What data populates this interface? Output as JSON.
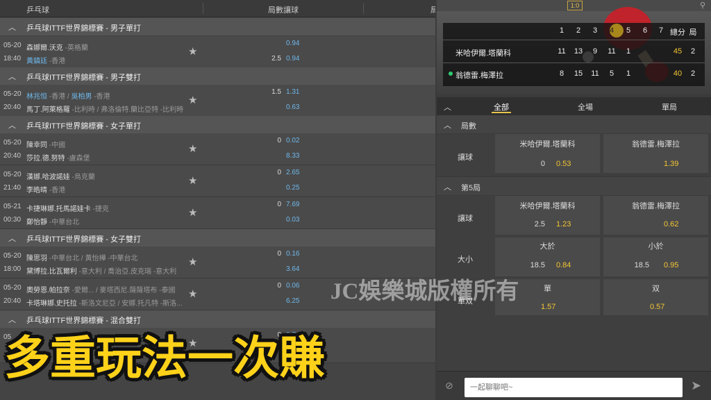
{
  "left_header": {
    "sport": "乒乓球",
    "col_games_handicap": "局數讓球",
    "col_more": "局"
  },
  "sections": [
    {
      "title": "乒乓球ITTF世界錦標賽 - 男子單打"
    },
    {
      "title": "乒乓球ITTF世界錦標賽 - 男子雙打"
    },
    {
      "title": "乒乓球ITTF世界錦標賽 - 女子單打"
    },
    {
      "title": "乒乓球ITTF世界錦標賽 - 女子雙打"
    },
    {
      "title": "乒乓球ITTF世界錦標賽 - 混合雙打"
    }
  ],
  "matches": [
    {
      "date": "05-20",
      "time": "18:40",
      "p1": "森娜爾.沃克",
      "c1": " -英格蘭",
      "p2": "黃鎮廷",
      "c2": " -香港",
      "h1": "",
      "h2": "2.5",
      "o1": "0.94",
      "o2": "0.94"
    },
    {
      "date": "05-20",
      "time": "20:40",
      "p1": "林兆恒",
      "c1": " -香港 / ",
      "p1b": "吳柏男",
      "c1b": " -香港",
      "p2": "馬丁.阿萊格羅",
      "c2": " -比利時 / 弗洛倫特.蘭比亞特 -比利時",
      "h1": "1.5",
      "h2": "",
      "o1": "1.31",
      "o2": "0.63"
    },
    {
      "date": "05-20",
      "time": "20:40",
      "p1": "陳幸同",
      "c1": " -中國",
      "p2": "莎拉.德.努特",
      "c2": " -盧森堡",
      "h1": "0",
      "h2": "",
      "o1": "0.02",
      "o2": "8.33"
    },
    {
      "date": "05-20",
      "time": "21:40",
      "p1": "漢娜.哈波諾娃",
      "c1": " -烏克蘭",
      "p2": "李皓晴",
      "c2": " -香港",
      "h1": "0",
      "h2": "",
      "o1": "2.65",
      "o2": "0.25"
    },
    {
      "date": "05-21",
      "time": "00:30",
      "p1": "卡捷琳娜.托馬諾娃卡",
      "c1": " -捷克",
      "p2": "鄭怡靜",
      "c2": " -中華台北",
      "h1": "0",
      "h2": "",
      "o1": "7.69",
      "o2": "0.03"
    },
    {
      "date": "05-20",
      "time": "18:00",
      "p1": "陳思羽",
      "c1": " -中華台北 / 黃怡樺 -中華台北",
      "p2": "黛博拉.比瓦爾利",
      "c2": " -意大利 / 喬治亞.皮克瑞 -意大利",
      "h1": "0",
      "h2": "",
      "o1": "0.16",
      "o2": "3.64"
    },
    {
      "date": "05-20",
      "time": "20:40",
      "p1": "奧勞恩.帕拉奈",
      "c1": " -愛爾... / 麥塔西尼.薩薩塔布 -泰國",
      "p2": "卡塔琳娜.史托拉",
      "c2": " -斯洛文尼亞 / 安娜.托凡特 -斯洛...",
      "h1": "0",
      "h2": "",
      "o1": "0.06",
      "o2": "6.25"
    },
    {
      "date": "05",
      "time": "",
      "p1": "",
      "c1": "",
      "p2": "",
      "c2": "",
      "h1": "0",
      "h2": "",
      "o1": "0.7",
      "o2": "10"
    }
  ],
  "scoreboard": {
    "score": "1:0",
    "sets": [
      "1",
      "2",
      "3",
      "4",
      "5",
      "6",
      "7"
    ],
    "total_label": "總分",
    "games_label": "局",
    "players": [
      {
        "name": "米哈伊爾.塔蘭科",
        "scores": [
          "11",
          "13",
          "9",
          "11",
          "1"
        ],
        "total": "45",
        "games": "2"
      },
      {
        "name": "翁德雷.梅澤拉",
        "scores": [
          "8",
          "15",
          "11",
          "5",
          "1"
        ],
        "total": "40",
        "games": "2"
      }
    ]
  },
  "tabs": [
    "全部",
    "全場",
    "單局"
  ],
  "markets": {
    "group1_title": "局數",
    "group2_title": "第5局",
    "handicap_label": "讓球",
    "ou_label": "大小",
    "oe_label": "單双",
    "p1": "米哈伊爾.塔蘭科",
    "p2": "翁德雷.梅澤拉",
    "g1_h1": "0",
    "g1_o1": "0.53",
    "g1_o2": "1.39",
    "g2_h1": "2.5",
    "g2_o1": "1.23",
    "g2_o2": "0.62",
    "over": "大於",
    "under": "小於",
    "ou_h1": "18.5",
    "ou_o1": "0.84",
    "ou_h2": "18.5",
    "ou_o2": "0.95",
    "odd": "單",
    "even": "双",
    "oe_o1": "1.57",
    "oe_o2": "0.57"
  },
  "chat": {
    "placeholder": "一起聊聊吧~"
  },
  "watermark": "JC娛樂城版權所有",
  "caption": "多重玩法一次賺",
  "colors": {
    "accent": "#e8c44a",
    "odds_blue": "#6fb7ea",
    "odds_yellow": "#f4c534",
    "caption": "#ffd21a"
  }
}
